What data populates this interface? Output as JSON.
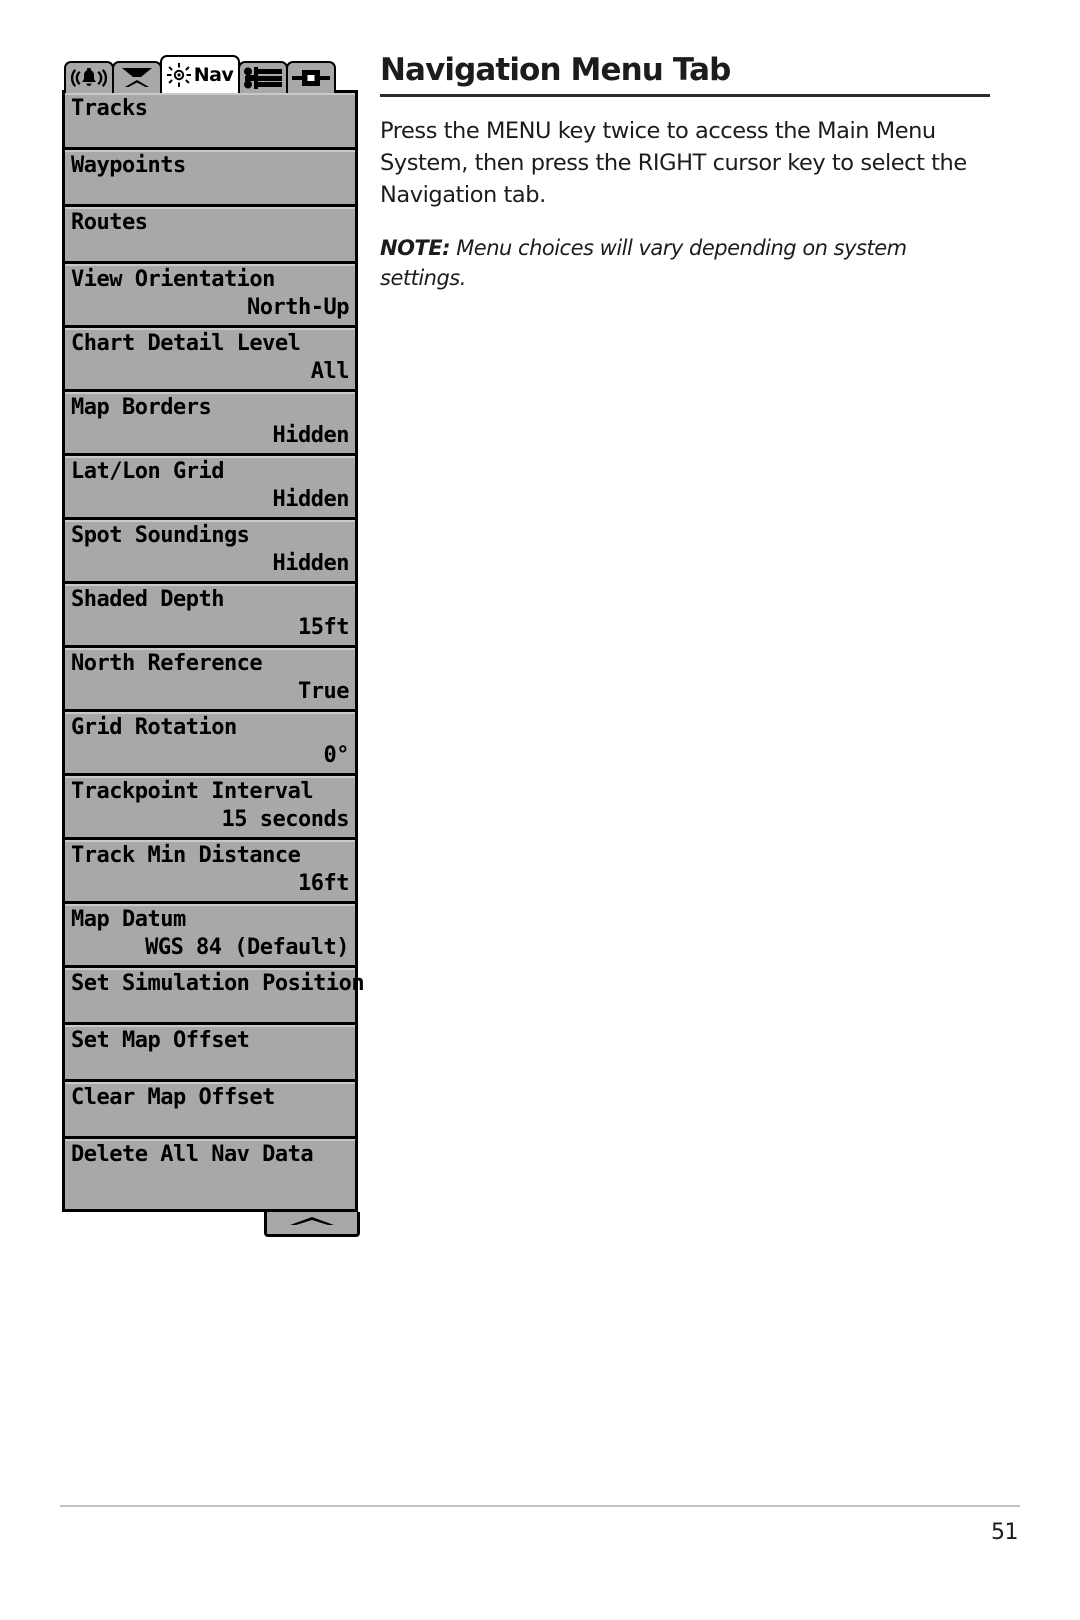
{
  "page": {
    "heading": "Navigation Menu Tab",
    "body_paragraph": "Press the MENU key twice to access the Main Menu System, then press the RIGHT cursor key to select the Navigation tab.",
    "note_label": "NOTE:",
    "note_text": "Menu choices will vary depending on system settings.",
    "page_number": "51"
  },
  "lcd": {
    "tabs": [
      {
        "icon": "alarm-bell-icon",
        "label": "",
        "active": false
      },
      {
        "icon": "sonar-transducer-icon",
        "label": "",
        "active": false
      },
      {
        "icon": "nav-compass-icon",
        "label": "Nav",
        "active": true
      },
      {
        "icon": "setup-sliders-icon",
        "label": "",
        "active": false
      },
      {
        "icon": "accessory-icon",
        "label": "",
        "active": false
      }
    ],
    "scroll_indicator_icon": "scroll-up-arrow-icon",
    "menu_items": [
      {
        "label": "Tracks",
        "value": ""
      },
      {
        "label": "Waypoints",
        "value": ""
      },
      {
        "label": "Routes",
        "value": ""
      },
      {
        "label": "View Orientation",
        "value": "North-Up"
      },
      {
        "label": "Chart Detail Level",
        "value": "All"
      },
      {
        "label": "Map Borders",
        "value": "Hidden"
      },
      {
        "label": "Lat/Lon Grid",
        "value": "Hidden"
      },
      {
        "label": "Spot Soundings",
        "value": "Hidden"
      },
      {
        "label": "Shaded Depth",
        "value": "15ft"
      },
      {
        "label": "North Reference",
        "value": "True"
      },
      {
        "label": "Grid Rotation",
        "value": "0°"
      },
      {
        "label": "Trackpoint Interval",
        "value": "15 seconds"
      },
      {
        "label": "Track Min Distance",
        "value": "16ft"
      },
      {
        "label": "Map Datum",
        "value": "WGS 84 (Default)"
      },
      {
        "label": "Set Simulation Position",
        "value": ""
      },
      {
        "label": "Set Map Offset",
        "value": ""
      },
      {
        "label": "Clear Map Offset",
        "value": ""
      },
      {
        "label": "Delete All Nav Data",
        "value": ""
      }
    ]
  },
  "colors": {
    "lcd_background": "#a8a8a8",
    "lcd_outline": "#000000",
    "active_tab": "#ffffff",
    "text": "#1c1c1c"
  }
}
